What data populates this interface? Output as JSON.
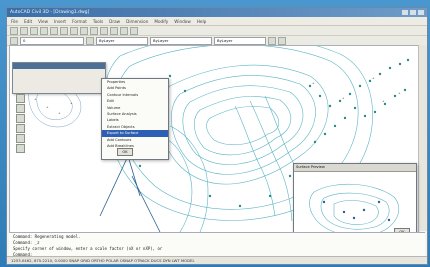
{
  "window": {
    "title": "AutoCAD Civil 3D - [Drawing1.dwg]"
  },
  "colors": {
    "frame": "#3d8cc4",
    "titlebar": "#3a6ea8",
    "contour": "#5ab4c4",
    "points": "#2a8a86",
    "selection": "#2f5fb4"
  },
  "menus": [
    "File",
    "Edit",
    "View",
    "Insert",
    "Format",
    "Tools",
    "Draw",
    "Dimension",
    "Modify",
    "Window",
    "Help"
  ],
  "toolbar": {
    "layer_combo": "0",
    "color_combo": "ByLayer",
    "linetype_combo": "ByLayer",
    "lineweight_combo": "ByLayer"
  },
  "context_menu": {
    "items": [
      "Properties",
      "Add Points",
      "Contour Intervals",
      "Edit",
      "Volume",
      "Surface Analysis",
      "Labels",
      "Extract Objects",
      "Export to Surface",
      "Add Contours",
      "Add Breaklines"
    ],
    "selected_index": 8
  },
  "dialog_ok": "OK",
  "inset_title": "Surface Preview",
  "command": {
    "lines": [
      "Command: Regenerating model.",
      "Command: _z",
      "Specify corner of window, enter a scale factor (nX or nXP), or",
      "Command:"
    ]
  },
  "status": {
    "text": "1253.0462, 875.2210, 0.0000   SNAP  GRID  ORTHO  POLAR  OSNAP  OTRACK  DUCS  DYN  LWT  MODEL"
  }
}
